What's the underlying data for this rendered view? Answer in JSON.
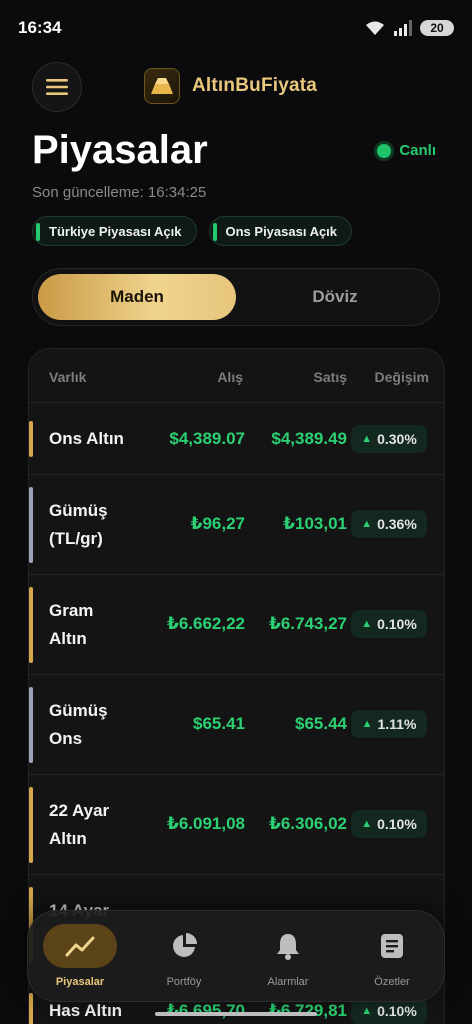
{
  "status": {
    "time": "16:34",
    "battery": "20"
  },
  "header": {
    "brand": "AltınBuFiyata"
  },
  "page": {
    "title": "Piyasalar",
    "live_label": "Canlı",
    "updated": "Son güncelleme: 16:34:25",
    "pills": [
      "Türkiye Piyasası Açık",
      "Ons Piyasası Açık"
    ]
  },
  "tabs": {
    "active": "Maden",
    "inactive": "Döviz"
  },
  "table": {
    "headers": {
      "name": "Varlık",
      "buy": "Alış",
      "sell": "Satış",
      "change": "Değişim"
    },
    "rows": [
      {
        "name": "Ons Altın",
        "buy": "$4,389.07",
        "sell": "$4,389.49",
        "change": "0.30%",
        "accent": "#d4a84a"
      },
      {
        "name": "Gümüş (TL/gr)",
        "buy": "₺96,27",
        "sell": "₺103,01",
        "change": "0.36%",
        "accent": "#9aa6b8"
      },
      {
        "name": "Gram Altın",
        "buy": "₺6.662,22",
        "sell": "₺6.743,27",
        "change": "0.10%",
        "accent": "#d4a84a"
      },
      {
        "name": "Gümüş Ons",
        "buy": "$65.41",
        "sell": "$65.44",
        "change": "1.11%",
        "accent": "#9aa6b8"
      },
      {
        "name": "22 Ayar Altın",
        "buy": "₺6.091,08",
        "sell": "₺6.306,02",
        "change": "0.10%",
        "accent": "#d4a84a"
      },
      {
        "name": "14 Ayar",
        "buy": "",
        "sell": "",
        "change": "",
        "accent": "#d4a84a"
      },
      {
        "name": "Has Altın",
        "buy": "₺6.695,70",
        "sell": "₺6.729,81",
        "change": "0.10%",
        "accent": "#d4a84a"
      }
    ]
  },
  "nav": {
    "items": [
      {
        "label": "Piyasalar",
        "icon": "trend-chart-icon"
      },
      {
        "label": "Portföy",
        "icon": "pie-chart-icon"
      },
      {
        "label": "Alarmlar",
        "icon": "bell-icon"
      },
      {
        "label": "Özetler",
        "icon": "document-icon"
      }
    ]
  }
}
